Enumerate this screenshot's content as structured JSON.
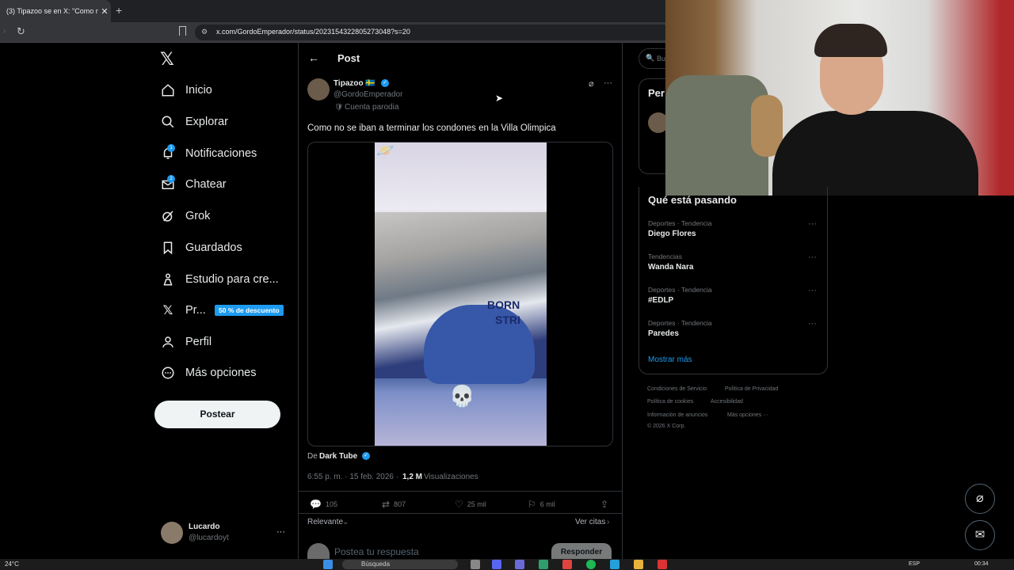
{
  "browser": {
    "tab_title": "(3) Tipazoo se en X: \"Como no",
    "tab_close": "✕",
    "new_tab": "+",
    "url": "x.com/GordoEmperador/status/2023154322805273048?s=20"
  },
  "nav": {
    "logo": "𝕏",
    "items": [
      {
        "label": "Inicio",
        "icon": "home-icon"
      },
      {
        "label": "Explorar",
        "icon": "search-icon"
      },
      {
        "label": "Notificaciones",
        "icon": "bell-icon",
        "badge": "1"
      },
      {
        "label": "Chatear",
        "icon": "mail-icon",
        "badge": "2"
      },
      {
        "label": "Grok",
        "icon": "grok-icon"
      },
      {
        "label": "Guardados",
        "icon": "bookmark-icon"
      },
      {
        "label": "Estudio para cre...",
        "icon": "creator-studio-icon"
      },
      {
        "label": "Pr...",
        "icon": "x-premium-icon"
      },
      {
        "label": "Perfil",
        "icon": "person-icon"
      },
      {
        "label": "Más opciones",
        "icon": "more-circle-icon"
      }
    ],
    "promo_badge": "50 % de descuento",
    "post_button": "Postear"
  },
  "account": {
    "name": "Lucardo",
    "handle": "@lucardoyt",
    "menu": "···"
  },
  "post": {
    "header_title": "Post",
    "back": "←",
    "author_name": "Tipazoo 🇸🇪",
    "author_handle": "@GordoEmperador",
    "parody_label": "Cuenta parodia",
    "text": "Como no se iban a terminar los condones en la Villa Olimpica",
    "video_overlay_text": "BORN",
    "video_overlay_text2": "STRI",
    "source_prefix": "De",
    "source_name": "Dark Tube",
    "timestamp": "6:55 p. m. · 15 feb. 2026 ·",
    "views_count": "1,2 M",
    "views_label": "Visualizaciones",
    "replies": "105",
    "reposts": "807",
    "likes": "25 mil",
    "bookmarks": "6 mil",
    "sort_label": "Relevante",
    "quotes_link": "Ver citas",
    "reply_placeholder": "Postea tu respuesta",
    "reply_button": "Responder",
    "more": "···"
  },
  "sidebar": {
    "search_placeholder": "Bu",
    "section_partial": "Per",
    "trends_title": "Qué está pasando",
    "trends": [
      {
        "category": "Deportes · Tendencia",
        "name": "Diego Flores"
      },
      {
        "category": "Tendencias",
        "name": "Wanda Nara"
      },
      {
        "category": "Deportes · Tendencia",
        "name": "#EDLP"
      },
      {
        "category": "Deportes · Tendencia",
        "name": "Paredes"
      }
    ],
    "show_more": "Mostrar más",
    "footer": {
      "terms": "Condiciones de Servicio",
      "privacy": "Política de Privacidad",
      "cookies": "Política de cookies",
      "accessibility": "Accesibilidad",
      "ads": "Información de anuncios",
      "more": "Más opciones ···",
      "copyright": "© 2026 X Corp."
    }
  },
  "taskbar": {
    "weather": "24°C",
    "search": "Búsqueda",
    "lang": "ESP",
    "time": "00:34"
  },
  "colors": {
    "accent": "#1d9bf0",
    "bg": "#000000",
    "text": "#e7e9ea",
    "muted": "#71767b"
  }
}
